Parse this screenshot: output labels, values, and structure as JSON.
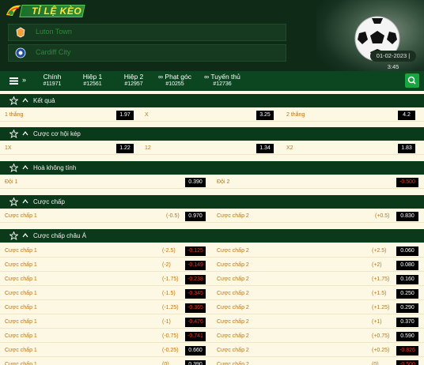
{
  "header": {
    "logo_text": "TỈ LỆ KÈO",
    "home_team": "Luton Town",
    "away_team": "Cardiff City",
    "datetime": "01-02-2023 | 3:45"
  },
  "tabs": [
    {
      "label": "Chính",
      "id": "#11971"
    },
    {
      "label": "Hiệp 1",
      "id": "#12561"
    },
    {
      "label": "Hiệp 2",
      "id": "#12957"
    },
    {
      "label": "Phạt góc",
      "id": "#10255"
    },
    {
      "label": "Tuyến thủ",
      "id": "#12736"
    }
  ],
  "sections": {
    "ket_qua": {
      "title": "Kết quả",
      "row": {
        "l1": "1 thắng",
        "v1": "1.97",
        "l2": "X",
        "v2": "3.25",
        "l3": "2 thắng",
        "v3": "4.2"
      }
    },
    "co_hoi_kep": {
      "title": "Cược cơ hội kép",
      "row": {
        "l1": "1X",
        "v1": "1.22",
        "l2": "12",
        "v2": "1.34",
        "l3": "X2",
        "v3": "1.83"
      }
    },
    "hoa_khong_tinh": {
      "title": "Hoà không tính",
      "row": {
        "l1": "Đội 1",
        "v1": "0.390",
        "l2": "Đội 2",
        "v2": "-0.500"
      }
    },
    "cuoc_chap": {
      "title": "Cược chấp",
      "row": {
        "l1": "Cược chấp 1",
        "h1": "(-0.5)",
        "v1": "0.970",
        "l2": "Cược chấp 2",
        "h2": "(+0.5)",
        "v2": "0.830"
      }
    },
    "chap_chau_a": {
      "title": "Cược chấp châu Á",
      "rows": [
        {
          "l1": "Cược chấp 1",
          "h1": "(-2.5)",
          "v1": "-0.125",
          "l2": "Cược chấp 2",
          "h2": "(+2.5)",
          "v2": "0.060"
        },
        {
          "l1": "Cược chấp 1",
          "h1": "(-2)",
          "v1": "-0.149",
          "l2": "Cược chấp 2",
          "h2": "(+2)",
          "v2": "0.080"
        },
        {
          "l1": "Cược chấp 1",
          "h1": "(-1.75)",
          "v1": "-0.238",
          "l2": "Cược chấp 2",
          "h2": "(+1.75)",
          "v2": "0.160"
        },
        {
          "l1": "Cược chấp 1",
          "h1": "(-1.5)",
          "v1": "-0.345",
          "l2": "Cược chấp 2",
          "h2": "(+1.5)",
          "v2": "0.250"
        },
        {
          "l1": "Cược chấp 1",
          "h1": "(-1.25)",
          "v1": "-0.365",
          "l2": "Cược chấp 2",
          "h2": "(+1.25)",
          "v2": "0.290"
        },
        {
          "l1": "Cược chấp 1",
          "h1": "(-1)",
          "v1": "-0.476",
          "l2": "Cược chấp 2",
          "h2": "(+1)",
          "v2": "0.370"
        },
        {
          "l1": "Cược chấp 1",
          "h1": "(-0.75)",
          "v1": "-0.741",
          "l2": "Cược chấp 2",
          "h2": "(+0.75)",
          "v2": "0.590"
        },
        {
          "l1": "Cược chấp 1",
          "h1": "(-0.25)",
          "v1": "0.660",
          "l2": "Cược chấp 2",
          "h2": "(+0.25)",
          "v2": "-0.826"
        },
        {
          "l1": "Cược chấp 1",
          "h1": "(0)",
          "v1": "0.390",
          "l2": "Cược chấp 2",
          "h2": "(0)",
          "v2": "-0.500"
        }
      ]
    }
  },
  "colors": {
    "header_bg": "#0f2a17",
    "section_bg": "#0b3a1b",
    "row_bg": "#fdf8e3",
    "label": "#b8761a",
    "negative": "#e23a2a",
    "accent": "#18a441"
  }
}
